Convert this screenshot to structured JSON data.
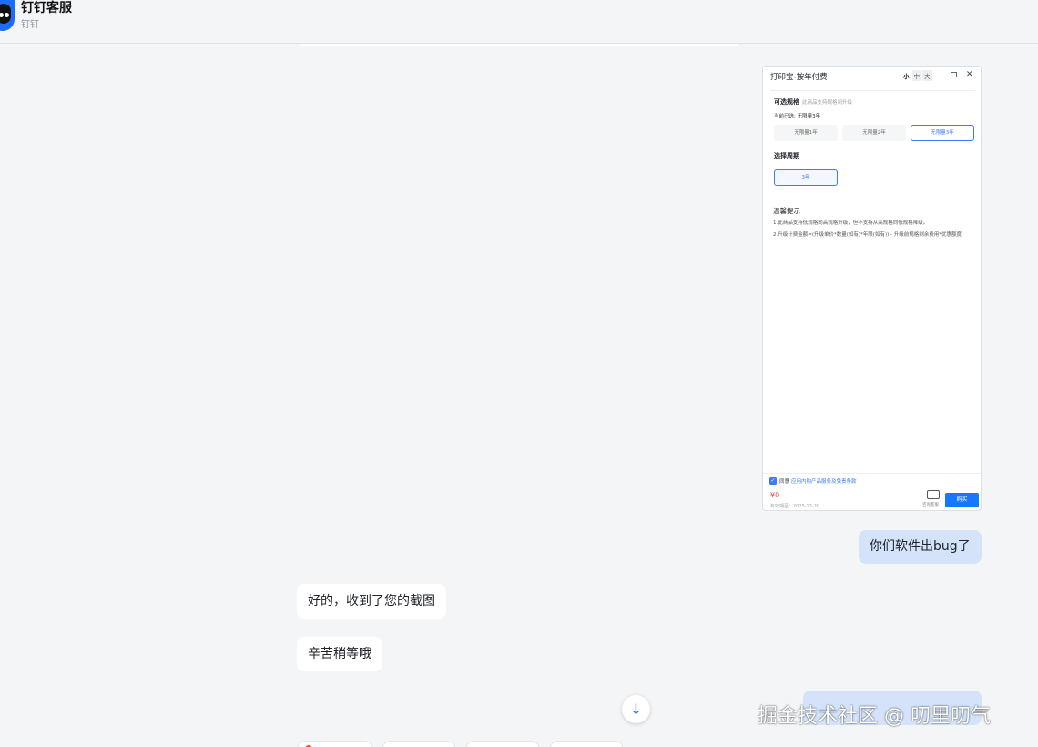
{
  "header": {
    "title": "钉钉客服",
    "subtitle": "钉钉"
  },
  "screenshot": {
    "window_title": "打印宝-按年付费",
    "size_options": [
      "小",
      "中",
      "大"
    ],
    "close_glyph": "✕",
    "spec_title": "可选规格",
    "spec_note": "此商品支持规格间升级",
    "current_selection": "当前已选: 无限量3年",
    "spec_options": [
      "无限量1年",
      "无限量2年",
      "无限量3年"
    ],
    "period_title": "选择周期",
    "period_option": "3年",
    "tips_title": "温馨提示",
    "tips": [
      "1.此商品支持低规格向高规格升级，但不支持从高规格向低规格降级。",
      "2.升级计费金额=(升级单价*数量(如有)*年限(如有)) - 升级前规格剩余费用*优惠额度"
    ],
    "agree_check": "✓",
    "agree_label": "同意",
    "agree_link": "应用内购产品服务及免责条款",
    "price": "¥0",
    "expire_label": "有效期至：2025-12-20",
    "service_label": "咨询客服",
    "buy_label": "购买"
  },
  "messages": [
    {
      "from": "me",
      "text": "你们软件出bug了"
    },
    {
      "from": "agent",
      "text": "好的，收到了您的截图"
    },
    {
      "from": "agent",
      "text": "辛苦稍等哦"
    }
  ],
  "scroll_down_glyph": "↓",
  "watermark": "掘金技术社区 @ 叨里叨气",
  "colors": {
    "accent": "#1677ff",
    "my_bubble": "#d4e3fa",
    "agent_bubble": "#ffffff",
    "background": "#f4f5f7",
    "price": "#f54a45"
  }
}
